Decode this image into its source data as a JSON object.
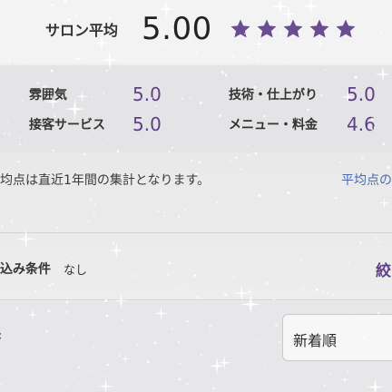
{
  "rating": {
    "label": "サロン平均",
    "score": "5.00",
    "stars_filled": 5,
    "stars_total": 5,
    "star_color": "#6a4c93"
  },
  "categories": [
    {
      "label": "雰囲気",
      "value": "5.0"
    },
    {
      "label": "接客サービス",
      "value": "5.0"
    },
    {
      "label": "技術・仕上がり",
      "value": "5.0"
    },
    {
      "label": "メニュー・料金",
      "value": "4.6"
    }
  ],
  "note": {
    "text": "均点は直近1年間の集計となります。",
    "link": "平均点の"
  },
  "filter": {
    "label": "込み条件",
    "value": "なし",
    "action": "絞"
  },
  "sort": {
    "selected": "新着順"
  },
  "colors": {
    "accent": "#5e3f87",
    "link": "#4a6ab0"
  }
}
